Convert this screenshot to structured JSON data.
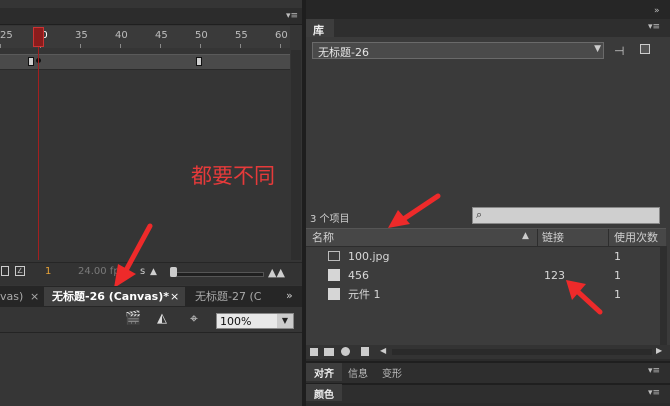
{
  "timeline": {
    "ruler_numbers": [
      "25",
      "30",
      "35",
      "40",
      "45",
      "50",
      "55",
      "60"
    ],
    "current_frame_display": "1",
    "fps": "24.00 fps",
    "time_suffix": "s"
  },
  "annotation": {
    "text": "都要不同"
  },
  "doc_tabs": [
    {
      "label": "vas)"
    },
    {
      "label": "无标题-26 (Canvas)*",
      "active": true
    },
    {
      "label": "无标题-27 (C"
    }
  ],
  "tab_close": "×",
  "stage_toolbar": {
    "zoom_value": "100%"
  },
  "library": {
    "title": "库",
    "doc_select": "无标题-26",
    "item_count": "3 个项目",
    "search_placeholder": "",
    "columns": {
      "name": "名称",
      "linkage": "链接",
      "usage": "使用次数"
    },
    "items": [
      {
        "name": "100.jpg",
        "icon": "image-icon",
        "linkage": "",
        "usage": "1"
      },
      {
        "name": "456",
        "icon": "movieclip-symbol-icon",
        "linkage": "123",
        "usage": "1"
      },
      {
        "name": "元件 1",
        "icon": "movieclip-symbol-icon",
        "linkage": "",
        "usage": "1"
      }
    ]
  },
  "bottom_panels": {
    "tabs": [
      "对齐",
      "信息",
      "变形"
    ],
    "color_panel": "颜色"
  },
  "colors": {
    "annotation_red": "#e63a3a",
    "arrow_red": "#ee2a2a",
    "playhead": "#a31f1f"
  }
}
